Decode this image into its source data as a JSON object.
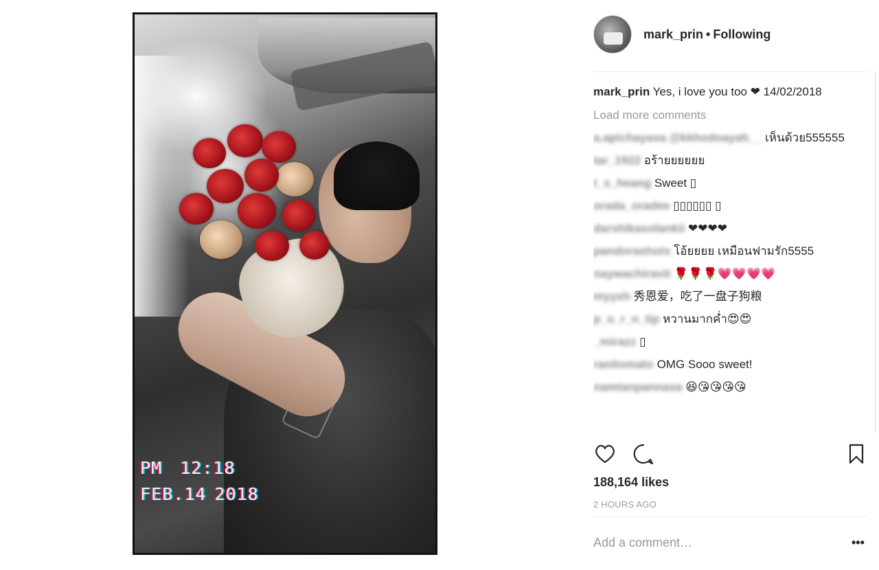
{
  "post": {
    "username": "mark_prin",
    "separator": "•",
    "follow_status": "Following",
    "caption_text": "Yes, i love you too ❤ 14/02/2018",
    "load_more": "Load more comments",
    "likes": "188,164 likes",
    "time": "2 HOURS AGO",
    "add_comment_placeholder": "Add a comment…",
    "more": "•••"
  },
  "photo": {
    "vhs_line1_a": "PM",
    "vhs_line1_b": "12:18",
    "vhs_line2_a": "FEB.14",
    "vhs_line2_b": "2018"
  },
  "comments": [
    {
      "user": "a.apichayasa @kkhodoayah__",
      "text": "เห็นด้วย555555"
    },
    {
      "user": "tar_1922",
      "text": "อร้ายยยยยย"
    },
    {
      "user": "t_s_heang",
      "text": "Sweet ▯"
    },
    {
      "user": "orada_oradee",
      "text": "▯▯▯▯▯▯ ▯"
    },
    {
      "user": "darshikasolankii",
      "text": "❤❤❤❤"
    },
    {
      "user": "pandorashots",
      "text": "โอ้ยยยย เหมือนฟามรัก5555"
    },
    {
      "user": "naywachiravit",
      "text": "🌹🌹🌹💗💗💗💗"
    },
    {
      "user": "myyxh",
      "text": "秀恩爱，吃了一盘子狗粮"
    },
    {
      "user": "p_o_r_n_tip",
      "text": "หวานมากค่ำ😍😍"
    },
    {
      "user": "_mirazz",
      "text": "▯"
    },
    {
      "user": "ranitomato",
      "text": "OMG Sooo sweet!"
    },
    {
      "user": "namtanpannasa",
      "text": "😆😘😘😘😘"
    }
  ],
  "icons": {
    "like": "heart-icon",
    "comment": "comment-bubble-icon",
    "save": "bookmark-icon"
  }
}
